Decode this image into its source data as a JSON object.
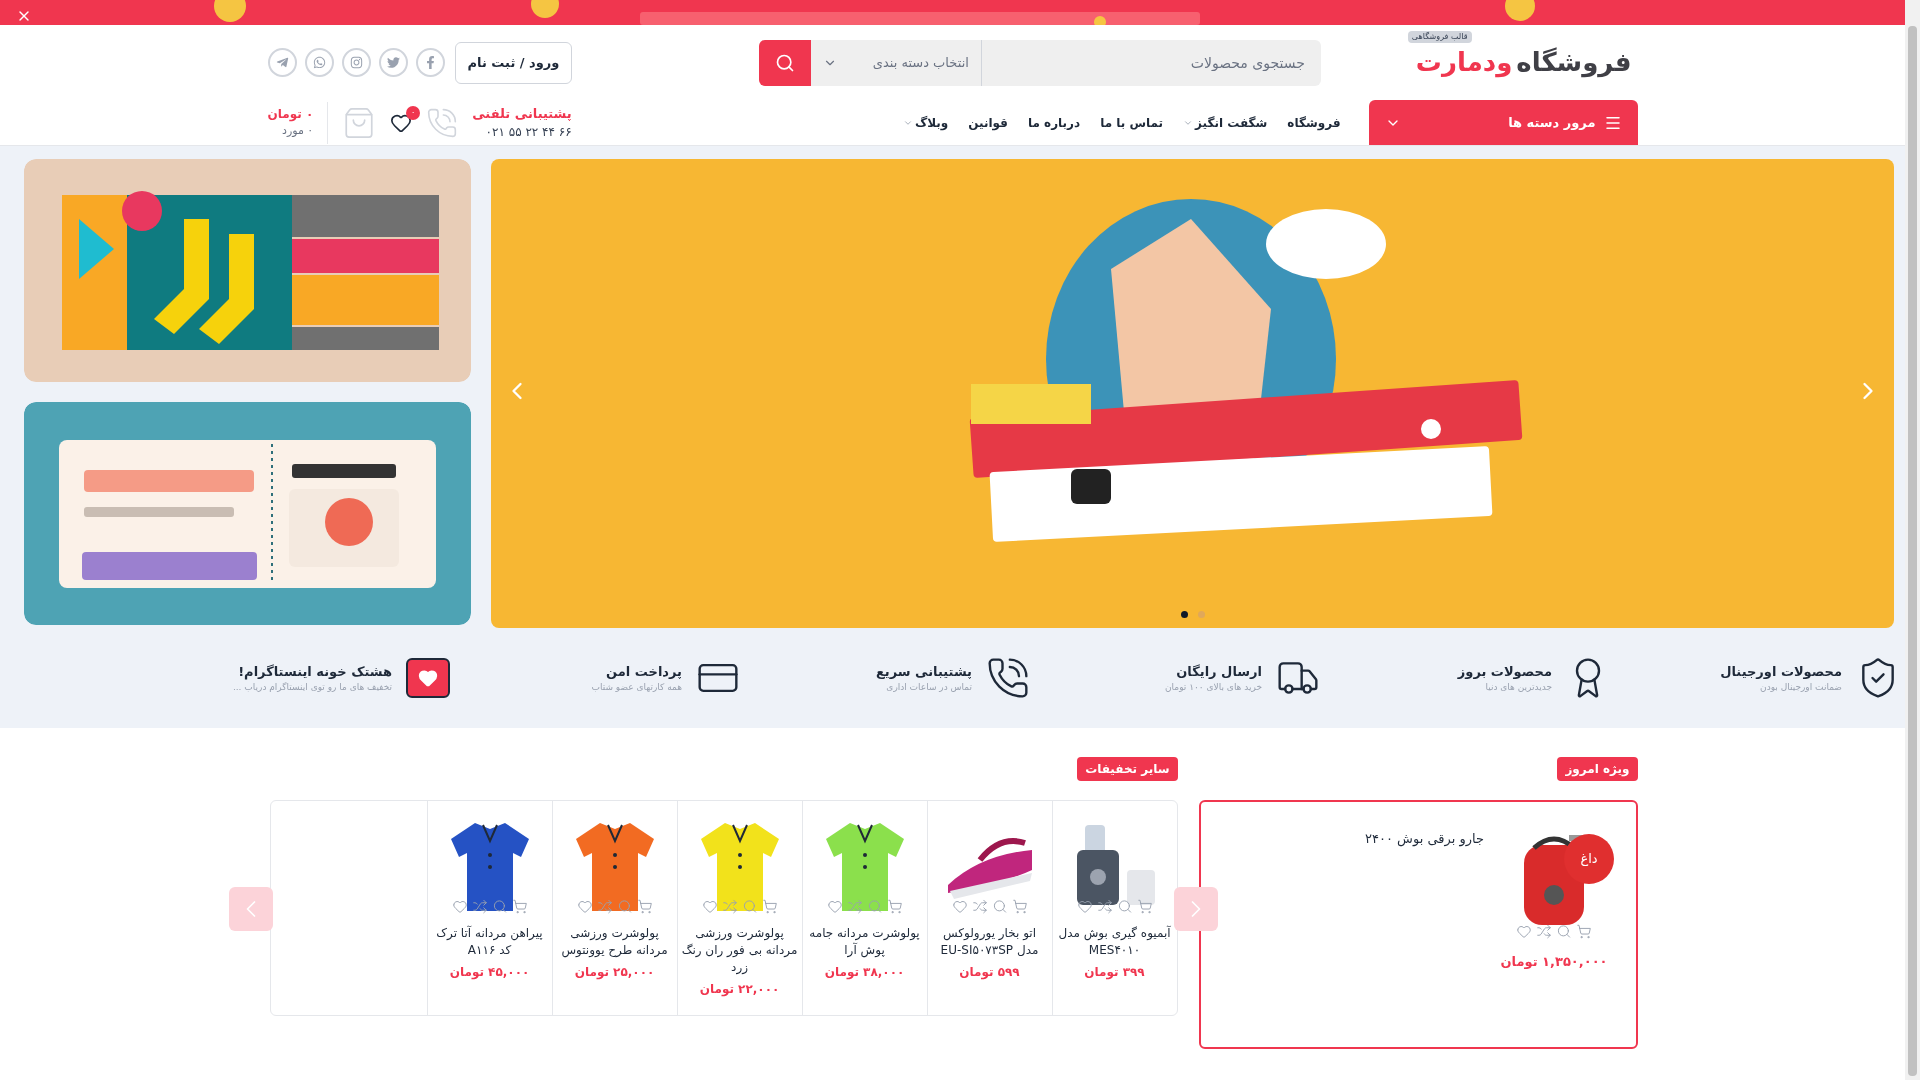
{
  "header": {
    "logo": {
      "primary": "فروشگاه",
      "accent": "ودمارت",
      "tag": "قالب فروشگاهی"
    },
    "search": {
      "placeholder": "جستجوی محصولات",
      "category": "انتخاب دسته بندی"
    },
    "login": "ورود / ثبت نام",
    "categories_button": "مرور دسته ها",
    "menu": [
      {
        "label": "فروشگاه",
        "dropdown": false
      },
      {
        "label": "شگفت انگیز",
        "dropdown": true
      },
      {
        "label": "تماس با ما",
        "dropdown": false
      },
      {
        "label": "درباره ما",
        "dropdown": false
      },
      {
        "label": "قوانین",
        "dropdown": false
      },
      {
        "label": "وبلاگ",
        "dropdown": true
      }
    ],
    "support": {
      "title": "پشتیبانی تلفنی",
      "phone": "۰۲۱ ۵۵ ۲۲ ۴۴ ۶۶"
    },
    "wishlist_count": "۰",
    "cart": {
      "total": "۰ تومان",
      "count": "۰ مورد"
    }
  },
  "slider": {
    "slides": [
      {
        "selected": true
      },
      {
        "selected": false
      }
    ]
  },
  "features": [
    {
      "kind": "original",
      "title": "محصولات اورجینال",
      "subtitle": "ضمانت اورجینال بودن"
    },
    {
      "kind": "new",
      "title": "محصولات بروز",
      "subtitle": "جدیدترین های دنیا"
    },
    {
      "kind": "shipping",
      "title": "ارسال رایگان",
      "subtitle": "خرید های بالای ۱۰۰ تومان"
    },
    {
      "kind": "support",
      "title": "پشتیبانی سریع",
      "subtitle": "تماس در ساعات اداری"
    },
    {
      "kind": "payment",
      "title": "پرداخت امن",
      "subtitle": "همه کارتهای عضو شتاب"
    },
    {
      "kind": "instagram",
      "title": "هشتک خونه اینستاگرام!",
      "subtitle": "تخفیف های ما رو توی اینستاگرام دریاب ..."
    }
  ],
  "special": {
    "heading": "ویژه امروز",
    "product": {
      "name": "جارو برقی بوش ۲۴۰۰",
      "badge": "داغ",
      "price": "۱,۳۵۰,۰۰۰ تومان"
    }
  },
  "discounts": {
    "heading": "سایر تخفیفات",
    "products": [
      {
        "name": "آبمیوه گیری بوش مدل MES۴۰۱۰",
        "price": "۳۹۹ تومان"
      },
      {
        "name": "اتو بخار یورولوکس مدل EU-SI۵۰۷۳SP",
        "price": "۵۹۹ تومان"
      },
      {
        "name": "پولوشرت مردانه جامه پوش آرا",
        "price": "۳۸,۰۰۰ تومان"
      },
      {
        "name": "پولوشرت ورزشی مردانه بی فور ران رنگ زرد",
        "price": "۲۲,۰۰۰ تومان"
      },
      {
        "name": "پولوشرت ورزشی مردانه طرح یوونتوس",
        "price": "۲۵,۰۰۰ تومان"
      },
      {
        "name": "پیراهن مردانه آتا ترک کد A۱۱۶",
        "price": "۴۵,۰۰۰ تومان"
      }
    ]
  }
}
